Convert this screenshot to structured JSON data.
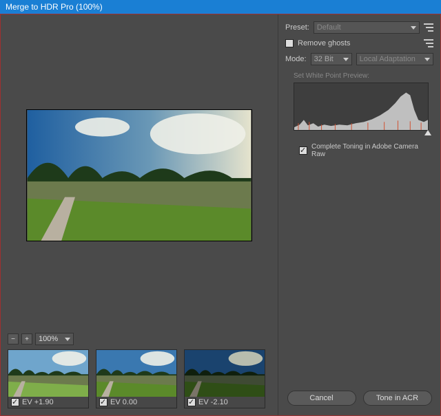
{
  "title": "Merge to HDR Pro (100%)",
  "zoom": {
    "minus_glyph": "−",
    "plus_glyph": "+",
    "value": "100%"
  },
  "thumbs": [
    {
      "ev": "EV +1.90",
      "checked": true
    },
    {
      "ev": "EV 0.00",
      "checked": true
    },
    {
      "ev": "EV -2.10",
      "checked": true
    }
  ],
  "preset": {
    "label": "Preset:",
    "value": "Default"
  },
  "remove_ghosts": {
    "label": "Remove ghosts",
    "checked": false
  },
  "mode": {
    "label": "Mode:",
    "bit_value": "32 Bit",
    "second_value": "Local Adaptation"
  },
  "white_point_label": "Set White Point Preview:",
  "complete_toning": {
    "label": "Complete Toning in Adobe Camera Raw",
    "checked": true
  },
  "buttons": {
    "cancel": "Cancel",
    "tone": "Tone in ACR"
  }
}
